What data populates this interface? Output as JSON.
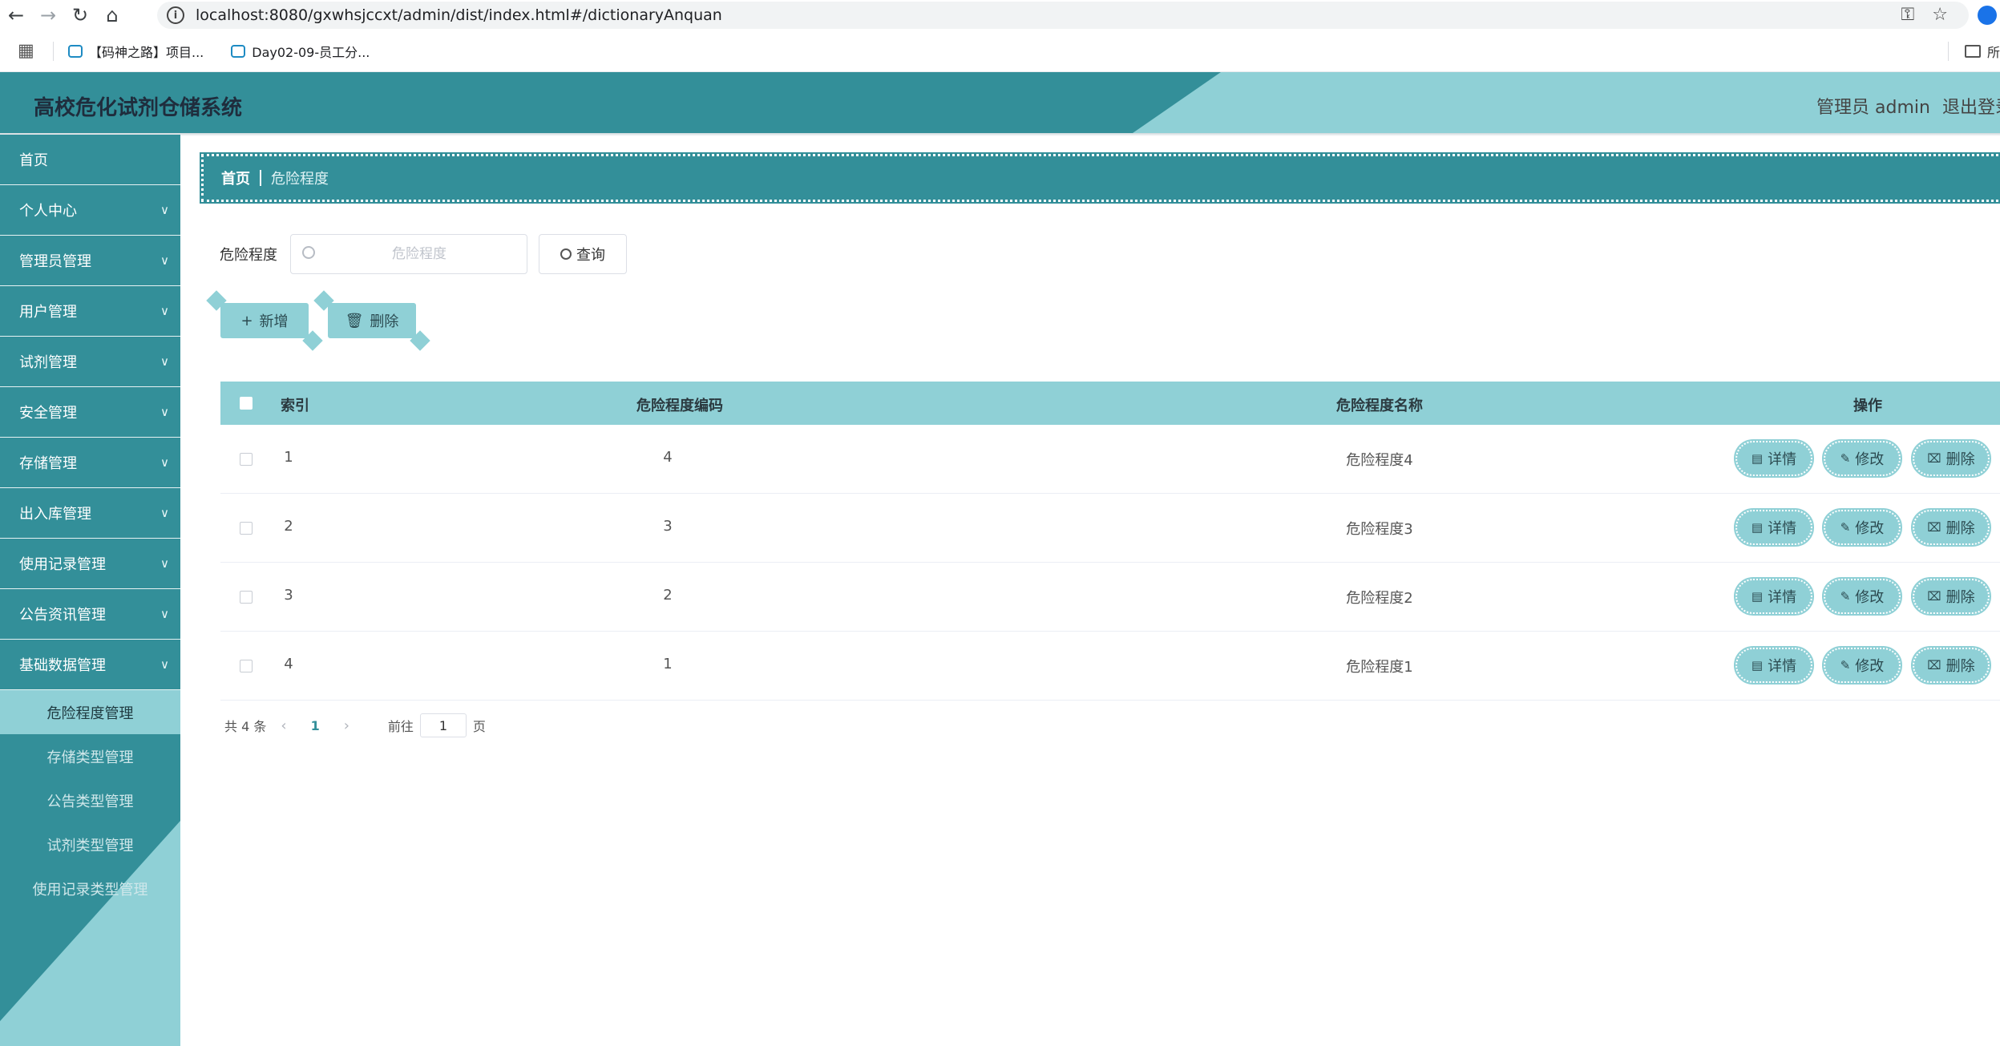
{
  "browser": {
    "url": "localhost:8080/gxwhsjccxt/admin/dist/index.html#/dictionaryAnquan",
    "bookmarks": [
      "【码神之路】项目...",
      "Day02-09-员工分..."
    ],
    "folder_label": "所"
  },
  "header": {
    "title": "高校危化试剂仓储系统",
    "admin_label": "管理员 admin",
    "logout_label": "退出登录"
  },
  "sidebar": {
    "items": [
      {
        "label": "首页",
        "has_children": false
      },
      {
        "label": "个人中心",
        "has_children": true
      },
      {
        "label": "管理员管理",
        "has_children": true
      },
      {
        "label": "用户管理",
        "has_children": true
      },
      {
        "label": "试剂管理",
        "has_children": true
      },
      {
        "label": "安全管理",
        "has_children": true
      },
      {
        "label": "存储管理",
        "has_children": true
      },
      {
        "label": "出入库管理",
        "has_children": true
      },
      {
        "label": "使用记录管理",
        "has_children": true
      },
      {
        "label": "公告资讯管理",
        "has_children": true
      },
      {
        "label": "基础数据管理",
        "has_children": true
      }
    ],
    "sub_items": [
      {
        "label": "危险程度管理",
        "active": true
      },
      {
        "label": "存储类型管理",
        "active": false
      },
      {
        "label": "公告类型管理",
        "active": false
      },
      {
        "label": "试剂类型管理",
        "active": false
      },
      {
        "label": "使用记录类型管理",
        "active": false
      }
    ]
  },
  "breadcrumb": {
    "home": "首页",
    "current": "危险程度"
  },
  "search": {
    "label": "危险程度",
    "placeholder": "危险程度",
    "value": "",
    "query_label": "查询"
  },
  "actions": {
    "add_label": "新增",
    "delete_label": "删除"
  },
  "table": {
    "headers": [
      "索引",
      "危险程度编码",
      "危险程度名称",
      "操作"
    ],
    "rows": [
      {
        "index": "1",
        "code": "4",
        "name": "危险程度4"
      },
      {
        "index": "2",
        "code": "3",
        "name": "危险程度3"
      },
      {
        "index": "3",
        "code": "2",
        "name": "危险程度2"
      },
      {
        "index": "4",
        "code": "1",
        "name": "危险程度1"
      }
    ],
    "row_actions": {
      "detail": "详情",
      "edit": "修改",
      "delete": "删除"
    }
  },
  "pagination": {
    "total_text": "共 4 条",
    "current_page": "1",
    "goto_prefix": "前往",
    "goto_value": "1",
    "goto_suffix": "页"
  },
  "colors": {
    "primary": "#338f99",
    "accent_light": "#8fd0d6"
  }
}
